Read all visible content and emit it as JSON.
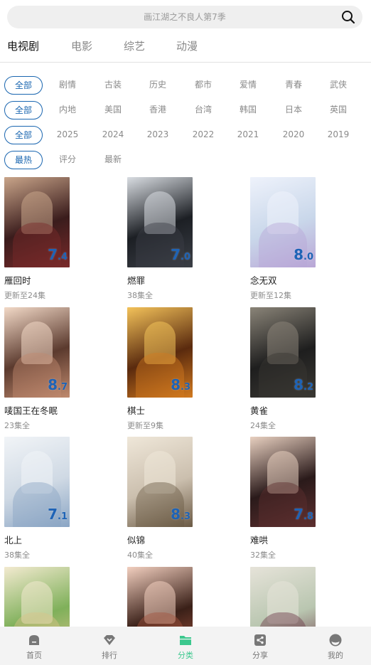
{
  "search": {
    "placeholder": "画江湖之不良人第7季"
  },
  "tabs": [
    {
      "label": "电视剧",
      "active": true
    },
    {
      "label": "电影",
      "active": false
    },
    {
      "label": "综艺",
      "active": false
    },
    {
      "label": "动漫",
      "active": false
    }
  ],
  "filters": {
    "genre": {
      "selected": "全部",
      "options": [
        "剧情",
        "古装",
        "历史",
        "都市",
        "爱情",
        "青春",
        "武侠"
      ]
    },
    "region": {
      "selected": "全部",
      "options": [
        "内地",
        "美国",
        "香港",
        "台湾",
        "韩国",
        "日本",
        "英国"
      ]
    },
    "year": {
      "selected": "全部",
      "options": [
        "2025",
        "2024",
        "2023",
        "2022",
        "2021",
        "2020",
        "2019"
      ]
    },
    "sort": {
      "selected": "最热",
      "options": [
        "评分",
        "最新"
      ]
    }
  },
  "shows": [
    {
      "title": "雁回时",
      "status": "更新至24集",
      "rating": "7.4",
      "colors": [
        "#3a1c1c",
        "#7a2a2a",
        "#c9a58a"
      ]
    },
    {
      "title": "燃罪",
      "status": "38集全",
      "rating": "7.0",
      "colors": [
        "#1c1f24",
        "#3b3f46",
        "#d9dde2"
      ]
    },
    {
      "title": "念无双",
      "status": "更新至12集",
      "rating": "8.0",
      "colors": [
        "#c9d7ea",
        "#b9a6d6",
        "#eef2fb"
      ]
    },
    {
      "title": "唛国王在冬眠",
      "status": "23集全",
      "rating": "8.7",
      "colors": [
        "#5b3a2e",
        "#c08a6e",
        "#f2d9c7"
      ]
    },
    {
      "title": "棋士",
      "status": "更新至9集",
      "rating": "8.3",
      "colors": [
        "#5a2a0e",
        "#d27a1f",
        "#f3c25a"
      ]
    },
    {
      "title": "黄雀",
      "status": "24集全",
      "rating": "8.2",
      "colors": [
        "#1e1e1e",
        "#3a3833",
        "#8a8478"
      ]
    },
    {
      "title": "北上",
      "status": "38集全",
      "rating": "7.1",
      "colors": [
        "#cfd9e4",
        "#8aa5c4",
        "#f1f4f7"
      ]
    },
    {
      "title": "似锦",
      "status": "40集全",
      "rating": "8.3",
      "colors": [
        "#cbbfae",
        "#6b5a45",
        "#efe7d9"
      ]
    },
    {
      "title": "难哄",
      "status": "32集全",
      "rating": "7.8",
      "colors": [
        "#2a1a1a",
        "#5d2f2f",
        "#e8d0c0"
      ]
    },
    {
      "title": "",
      "status": "",
      "rating": "",
      "colors": [
        "#7fb05a",
        "#d9c38a",
        "#f3ead0"
      ]
    },
    {
      "title": "",
      "status": "",
      "rating": "",
      "colors": [
        "#3a2018",
        "#a5543f",
        "#f2cfbf"
      ]
    },
    {
      "title": "",
      "status": "",
      "rating": "",
      "colors": [
        "#b9c6b0",
        "#6d3a4a",
        "#e6e3d9"
      ]
    }
  ],
  "bottom_nav": [
    {
      "label": "首页",
      "icon": "home-icon",
      "active": false
    },
    {
      "label": "排行",
      "icon": "ranking-icon",
      "active": false
    },
    {
      "label": "分类",
      "icon": "category-folder-icon",
      "active": true
    },
    {
      "label": "分享",
      "icon": "share-icon",
      "active": false
    },
    {
      "label": "我的",
      "icon": "profile-icon",
      "active": false
    }
  ],
  "theme": {
    "accent": "#1a66b0",
    "rating": "#1e63b6",
    "nav_active": "#3cc88e"
  }
}
